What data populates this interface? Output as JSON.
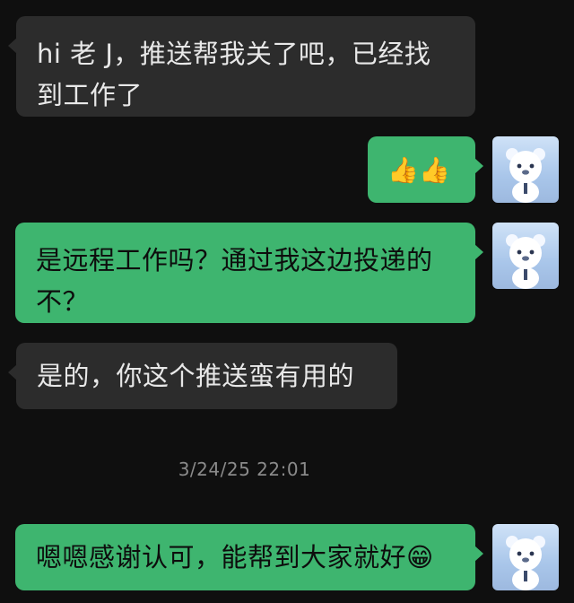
{
  "messages": [
    {
      "side": "in",
      "text": "hi 老 J，推送帮我关了吧，已经找到工作了"
    },
    {
      "side": "out",
      "text": "👍👍"
    },
    {
      "side": "out",
      "text": "是远程工作吗？通过我这边投递的不？"
    },
    {
      "side": "in",
      "text": "是的，你这个推送蛮有用的"
    },
    {
      "side": "out",
      "text": "嗯嗯感谢认可，能帮到大家就好😁"
    }
  ],
  "timestamp": "3/24/25 22:01",
  "avatar_icon": "white-bear-mascot-icon",
  "colors": {
    "background": "#0f0f0f",
    "incoming_bubble": "#2c2c2c",
    "outgoing_bubble": "#3eb56f"
  }
}
